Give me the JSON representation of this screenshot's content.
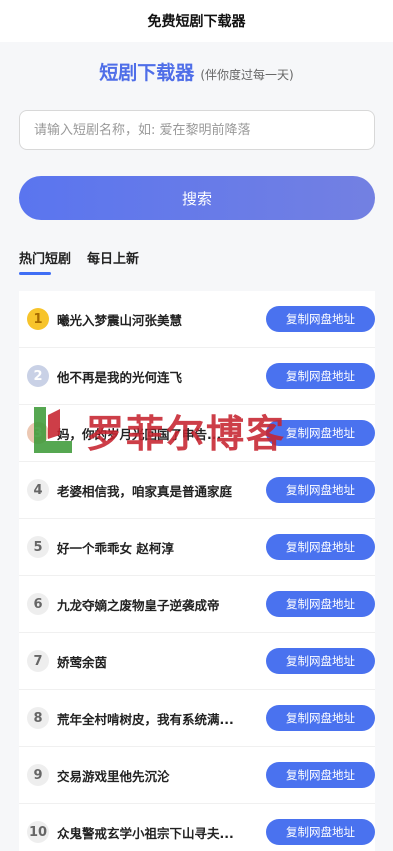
{
  "navbar": {
    "title": "免费短剧下载器"
  },
  "brand": {
    "name": "短剧下载器",
    "subtitle": "(伴你度过每一天)"
  },
  "search": {
    "placeholder": "请输入短剧名称，如: 爱在黎明前降落",
    "button_label": "搜索"
  },
  "tabs": [
    {
      "label": "热门短剧",
      "active": true
    },
    {
      "label": "每日上新",
      "active": false
    }
  ],
  "list": [
    {
      "rank": "1",
      "title": "曦光入梦震山河张美慧",
      "button": "复制网盘地址"
    },
    {
      "rank": "2",
      "title": "他不再是我的光何连飞",
      "button": "复制网盘地址"
    },
    {
      "rank": "3",
      "title": "妈，你的岁月光回国了申告...",
      "button": "复制网盘地址"
    },
    {
      "rank": "4",
      "title": "老婆相信我，咱家真是普通家庭",
      "button": "复制网盘地址"
    },
    {
      "rank": "5",
      "title": "好一个乖乖女 赵柯淳",
      "button": "复制网盘地址"
    },
    {
      "rank": "6",
      "title": "九龙夺嫡之废物皇子逆袭成帝",
      "button": "复制网盘地址"
    },
    {
      "rank": "7",
      "title": "娇莺余茵",
      "button": "复制网盘地址"
    },
    {
      "rank": "8",
      "title": "荒年全村啃树皮，我有系统满...",
      "button": "复制网盘地址"
    },
    {
      "rank": "9",
      "title": "交易游戏里他先沉沦",
      "button": "复制网盘地址"
    },
    {
      "rank": "10",
      "title": "众鬼警戒玄学小祖宗下山寻夫...",
      "button": "复制网盘地址"
    }
  ],
  "watermark": {
    "text": "罗菲尔博客"
  },
  "colors": {
    "accent": "#4a72ef",
    "brand": "#4f6ee8",
    "watermark": "#c7242f"
  }
}
